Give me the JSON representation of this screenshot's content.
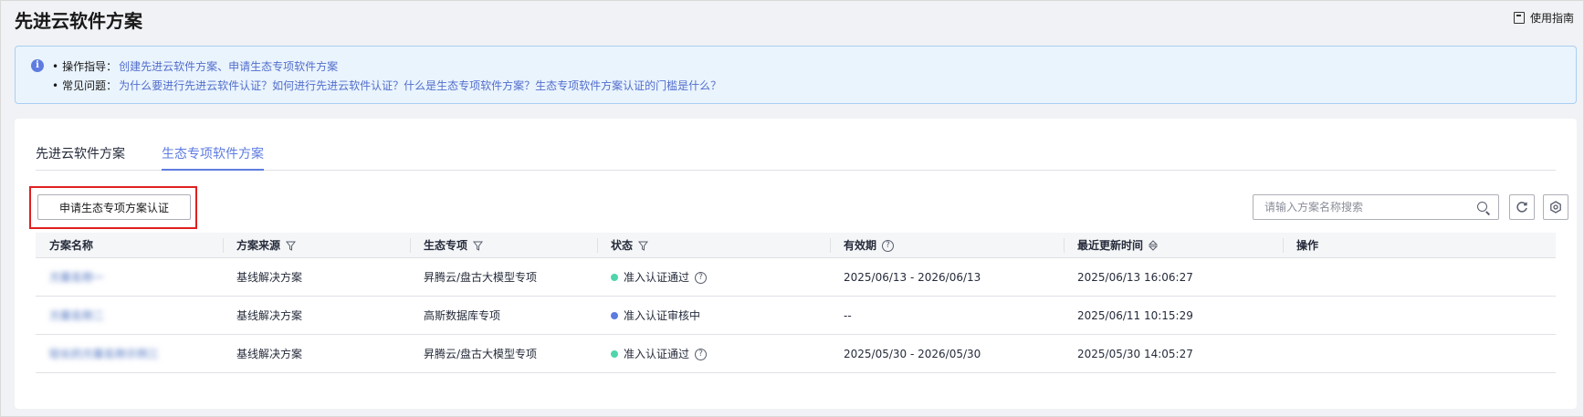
{
  "header": {
    "title": "先进云软件方案",
    "guide_label": "使用指南"
  },
  "notice": {
    "line1_label": "操作指导：",
    "line1_links": [
      "创建先进云软件方案、申请生态专项软件方案"
    ],
    "line2_label": "常见问题：",
    "line2_links": [
      "为什么要进行先进云软件认证？",
      "如何进行先进云软件认证？",
      "什么是生态专项软件方案？",
      "生态专项软件方案认证的门槛是什么？"
    ]
  },
  "tabs": [
    {
      "label": "先进云软件方案",
      "active": false
    },
    {
      "label": "生态专项软件方案",
      "active": true
    }
  ],
  "toolbar": {
    "apply_label": "申请生态专项方案认证",
    "search_placeholder": "请输入方案名称搜索"
  },
  "table": {
    "columns": [
      "方案名称",
      "方案来源",
      "生态专项",
      "状态",
      "有效期",
      "最近更新时间",
      "操作"
    ],
    "rows": [
      {
        "name": "方案名称一",
        "source": "基线解决方案",
        "special": "昇腾云/盘古大模型专项",
        "status": "准入认证通过",
        "status_color": "#50d4ab",
        "validity": "2025/06/13 - 2026/06/13",
        "updated": "2025/06/13 16:06:27",
        "show_help": true
      },
      {
        "name": "方案名称二",
        "source": "基线解决方案",
        "special": "高斯数据库专项",
        "status": "准入认证审核中",
        "status_color": "#5e7ce0",
        "validity": "--",
        "updated": "2025/06/11 10:15:29",
        "show_help": false
      },
      {
        "name": "较长的方案名称示例三",
        "source": "基线解决方案",
        "special": "昇腾云/盘古大模型专项",
        "status": "准入认证通过",
        "status_color": "#50d4ab",
        "validity": "2025/05/30 - 2026/05/30",
        "updated": "2025/05/30 14:05:27",
        "show_help": true
      }
    ]
  }
}
